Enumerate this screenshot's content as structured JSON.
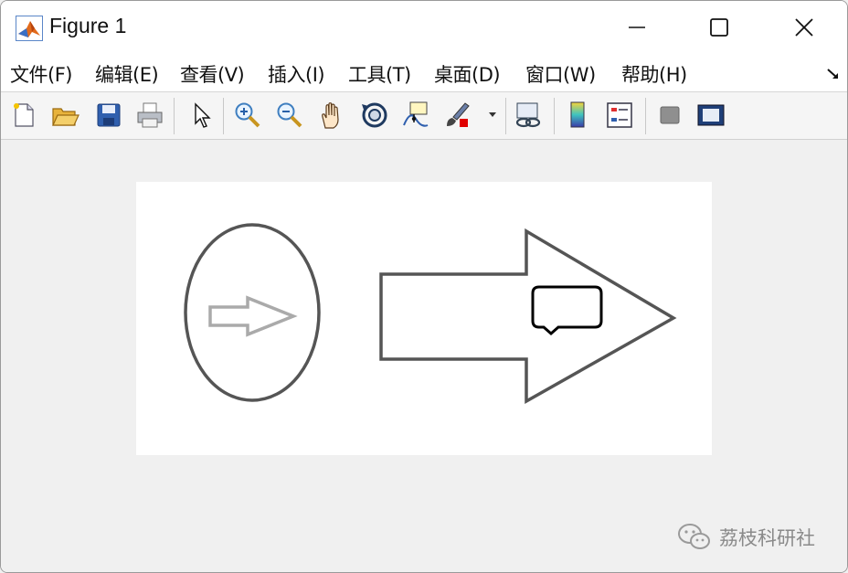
{
  "window": {
    "title": "Figure 1",
    "controls": [
      "minimize-icon",
      "maximize-icon",
      "close-icon"
    ]
  },
  "menu": {
    "items": [
      {
        "label": "文件(F)"
      },
      {
        "label": "编辑(E)"
      },
      {
        "label": "查看(V)"
      },
      {
        "label": "插入(I)"
      },
      {
        "label": "工具(T)"
      },
      {
        "label": "桌面(D)"
      },
      {
        "label": "窗口(W)"
      },
      {
        "label": "帮助(H)"
      }
    ]
  },
  "toolbar": {
    "tools": [
      "new-figure-icon",
      "open-file-icon",
      "save-icon",
      "print-icon",
      "pointer-icon",
      "zoom-in-icon",
      "zoom-out-icon",
      "pan-hand-icon",
      "rotate-3d-icon",
      "data-cursor-icon",
      "brush-icon",
      "link-plot-icon",
      "colorbar-icon",
      "legend-icon",
      "hide-plot-tools-icon",
      "show-plot-tools-icon"
    ]
  },
  "colors": {
    "shape_stroke": "#555555",
    "small_arrow_stroke": "#aaaaaa",
    "callout_stroke": "#000000",
    "brush_red": "#e00000"
  },
  "watermark": {
    "text": "荔枝科研社"
  }
}
